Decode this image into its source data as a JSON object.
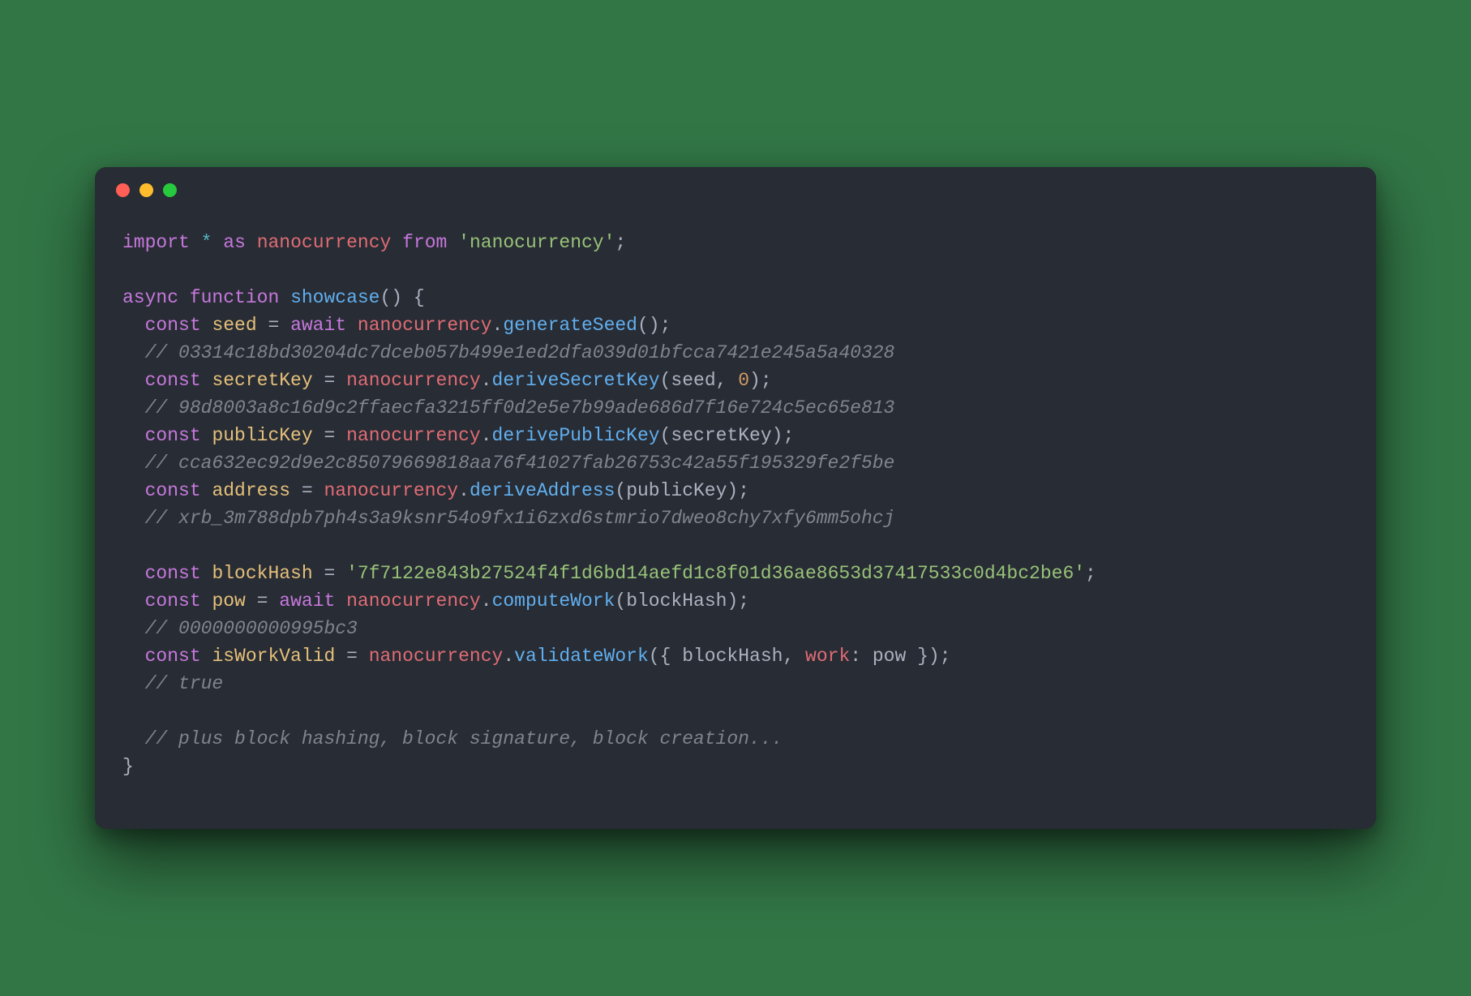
{
  "code": {
    "lines": [
      {
        "indent": 0,
        "tokens": [
          {
            "c": "tok-kw",
            "t": "import"
          },
          {
            "c": "tok-punct",
            "t": " "
          },
          {
            "c": "tok-star",
            "t": "*"
          },
          {
            "c": "tok-punct",
            "t": " "
          },
          {
            "c": "tok-kw",
            "t": "as"
          },
          {
            "c": "tok-punct",
            "t": " "
          },
          {
            "c": "tok-mod",
            "t": "nanocurrency"
          },
          {
            "c": "tok-punct",
            "t": " "
          },
          {
            "c": "tok-kw",
            "t": "from"
          },
          {
            "c": "tok-punct",
            "t": " "
          },
          {
            "c": "tok-str",
            "t": "'nanocurrency'"
          },
          {
            "c": "tok-punct",
            "t": ";"
          }
        ]
      },
      {
        "indent": 0,
        "tokens": []
      },
      {
        "indent": 0,
        "tokens": [
          {
            "c": "tok-kw",
            "t": "async"
          },
          {
            "c": "tok-punct",
            "t": " "
          },
          {
            "c": "tok-kw",
            "t": "function"
          },
          {
            "c": "tok-punct",
            "t": " "
          },
          {
            "c": "tok-fn",
            "t": "showcase"
          },
          {
            "c": "tok-punct",
            "t": "() {"
          }
        ]
      },
      {
        "indent": 1,
        "tokens": [
          {
            "c": "tok-kw",
            "t": "const"
          },
          {
            "c": "tok-punct",
            "t": " "
          },
          {
            "c": "tok-var",
            "t": "seed"
          },
          {
            "c": "tok-punct",
            "t": " = "
          },
          {
            "c": "tok-kw",
            "t": "await"
          },
          {
            "c": "tok-punct",
            "t": " "
          },
          {
            "c": "tok-mod",
            "t": "nanocurrency"
          },
          {
            "c": "tok-punct",
            "t": "."
          },
          {
            "c": "tok-fn",
            "t": "generateSeed"
          },
          {
            "c": "tok-punct",
            "t": "();"
          }
        ]
      },
      {
        "indent": 1,
        "tokens": [
          {
            "c": "tok-com",
            "t": "// 03314c18bd30204dc7dceb057b499e1ed2dfa039d01bfcca7421e245a5a40328"
          }
        ]
      },
      {
        "indent": 1,
        "tokens": [
          {
            "c": "tok-kw",
            "t": "const"
          },
          {
            "c": "tok-punct",
            "t": " "
          },
          {
            "c": "tok-var",
            "t": "secretKey"
          },
          {
            "c": "tok-punct",
            "t": " = "
          },
          {
            "c": "tok-mod",
            "t": "nanocurrency"
          },
          {
            "c": "tok-punct",
            "t": "."
          },
          {
            "c": "tok-fn",
            "t": "deriveSecretKey"
          },
          {
            "c": "tok-punct",
            "t": "("
          },
          {
            "c": "tok-ident",
            "t": "seed"
          },
          {
            "c": "tok-punct",
            "t": ", "
          },
          {
            "c": "tok-num",
            "t": "0"
          },
          {
            "c": "tok-punct",
            "t": ");"
          }
        ]
      },
      {
        "indent": 1,
        "tokens": [
          {
            "c": "tok-com",
            "t": "// 98d8003a8c16d9c2ffaecfa3215ff0d2e5e7b99ade686d7f16e724c5ec65e813"
          }
        ]
      },
      {
        "indent": 1,
        "tokens": [
          {
            "c": "tok-kw",
            "t": "const"
          },
          {
            "c": "tok-punct",
            "t": " "
          },
          {
            "c": "tok-var",
            "t": "publicKey"
          },
          {
            "c": "tok-punct",
            "t": " = "
          },
          {
            "c": "tok-mod",
            "t": "nanocurrency"
          },
          {
            "c": "tok-punct",
            "t": "."
          },
          {
            "c": "tok-fn",
            "t": "derivePublicKey"
          },
          {
            "c": "tok-punct",
            "t": "("
          },
          {
            "c": "tok-ident",
            "t": "secretKey"
          },
          {
            "c": "tok-punct",
            "t": ");"
          }
        ]
      },
      {
        "indent": 1,
        "tokens": [
          {
            "c": "tok-com",
            "t": "// cca632ec92d9e2c85079669818aa76f41027fab26753c42a55f195329fe2f5be"
          }
        ]
      },
      {
        "indent": 1,
        "tokens": [
          {
            "c": "tok-kw",
            "t": "const"
          },
          {
            "c": "tok-punct",
            "t": " "
          },
          {
            "c": "tok-var",
            "t": "address"
          },
          {
            "c": "tok-punct",
            "t": " = "
          },
          {
            "c": "tok-mod",
            "t": "nanocurrency"
          },
          {
            "c": "tok-punct",
            "t": "."
          },
          {
            "c": "tok-fn",
            "t": "deriveAddress"
          },
          {
            "c": "tok-punct",
            "t": "("
          },
          {
            "c": "tok-ident",
            "t": "publicKey"
          },
          {
            "c": "tok-punct",
            "t": ");"
          }
        ]
      },
      {
        "indent": 1,
        "tokens": [
          {
            "c": "tok-com",
            "t": "// xrb_3m788dpb7ph4s3a9ksnr54o9fx1i6zxd6stmrio7dweo8chy7xfy6mm5ohcj"
          }
        ]
      },
      {
        "indent": 0,
        "tokens": []
      },
      {
        "indent": 1,
        "tokens": [
          {
            "c": "tok-kw",
            "t": "const"
          },
          {
            "c": "tok-punct",
            "t": " "
          },
          {
            "c": "tok-var",
            "t": "blockHash"
          },
          {
            "c": "tok-punct",
            "t": " = "
          },
          {
            "c": "tok-str",
            "t": "'7f7122e843b27524f4f1d6bd14aefd1c8f01d36ae8653d37417533c0d4bc2be6'"
          },
          {
            "c": "tok-punct",
            "t": ";"
          }
        ]
      },
      {
        "indent": 1,
        "tokens": [
          {
            "c": "tok-kw",
            "t": "const"
          },
          {
            "c": "tok-punct",
            "t": " "
          },
          {
            "c": "tok-var",
            "t": "pow"
          },
          {
            "c": "tok-punct",
            "t": " = "
          },
          {
            "c": "tok-kw",
            "t": "await"
          },
          {
            "c": "tok-punct",
            "t": " "
          },
          {
            "c": "tok-mod",
            "t": "nanocurrency"
          },
          {
            "c": "tok-punct",
            "t": "."
          },
          {
            "c": "tok-fn",
            "t": "computeWork"
          },
          {
            "c": "tok-punct",
            "t": "("
          },
          {
            "c": "tok-ident",
            "t": "blockHash"
          },
          {
            "c": "tok-punct",
            "t": ");"
          }
        ]
      },
      {
        "indent": 1,
        "tokens": [
          {
            "c": "tok-com",
            "t": "// 0000000000995bc3"
          }
        ]
      },
      {
        "indent": 1,
        "tokens": [
          {
            "c": "tok-kw",
            "t": "const"
          },
          {
            "c": "tok-punct",
            "t": " "
          },
          {
            "c": "tok-var",
            "t": "isWorkValid"
          },
          {
            "c": "tok-punct",
            "t": " = "
          },
          {
            "c": "tok-mod",
            "t": "nanocurrency"
          },
          {
            "c": "tok-punct",
            "t": "."
          },
          {
            "c": "tok-fn",
            "t": "validateWork"
          },
          {
            "c": "tok-punct",
            "t": "({ "
          },
          {
            "c": "tok-ident",
            "t": "blockHash"
          },
          {
            "c": "tok-punct",
            "t": ", "
          },
          {
            "c": "tok-prop",
            "t": "work"
          },
          {
            "c": "tok-punct",
            "t": ": "
          },
          {
            "c": "tok-ident",
            "t": "pow"
          },
          {
            "c": "tok-punct",
            "t": " });"
          }
        ]
      },
      {
        "indent": 1,
        "tokens": [
          {
            "c": "tok-com",
            "t": "// true"
          }
        ]
      },
      {
        "indent": 0,
        "tokens": []
      },
      {
        "indent": 1,
        "tokens": [
          {
            "c": "tok-com",
            "t": "// plus block hashing, block signature, block creation..."
          }
        ]
      },
      {
        "indent": 0,
        "tokens": [
          {
            "c": "tok-punct",
            "t": "}"
          }
        ]
      }
    ]
  }
}
